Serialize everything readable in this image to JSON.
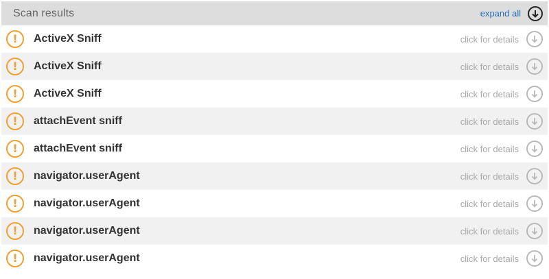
{
  "header": {
    "title": "Scan results",
    "expand_label": "expand all"
  },
  "rows": [
    {
      "label": "ActiveX Sniff",
      "details": "click for details"
    },
    {
      "label": "ActiveX Sniff",
      "details": "click for details"
    },
    {
      "label": "ActiveX Sniff",
      "details": "click for details"
    },
    {
      "label": "attachEvent sniff",
      "details": "click for details"
    },
    {
      "label": "attachEvent sniff",
      "details": "click for details"
    },
    {
      "label": "navigator.userAgent",
      "details": "click for details"
    },
    {
      "label": "navigator.userAgent",
      "details": "click for details"
    },
    {
      "label": "navigator.userAgent",
      "details": "click for details"
    },
    {
      "label": "navigator.userAgent",
      "details": "click for details"
    }
  ],
  "icons": {
    "row_status": "warning-icon",
    "row_expand": "arrow-down-circle-icon",
    "header_expand": "arrow-down-circle-icon"
  },
  "colors": {
    "header_bg": "#dddddd",
    "warning": "#f0a030",
    "link": "#2a6ebb",
    "muted": "#a8a8a8",
    "alt_row": "#f1f1f1"
  }
}
